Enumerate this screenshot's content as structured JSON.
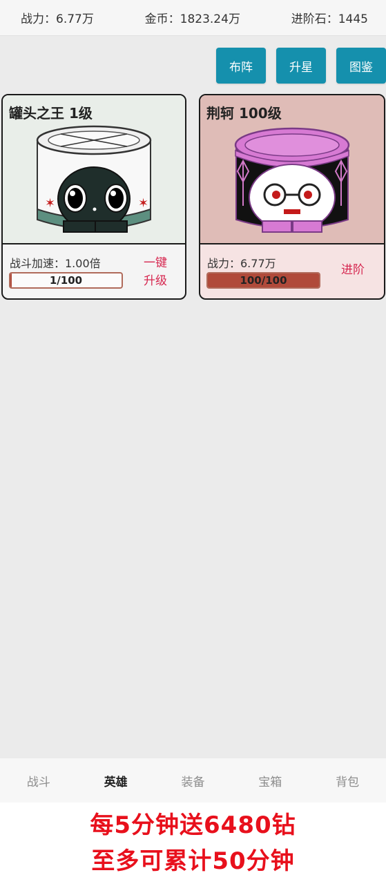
{
  "header": {
    "power": "战力：6.77万",
    "gold": "金币：1823.24万",
    "advance_stone": "进阶石：1445"
  },
  "toolbar": {
    "formation": "布阵",
    "star_up": "升星",
    "codex": "图鉴"
  },
  "heroes": [
    {
      "name": "罐头之王 1级",
      "stat": "战斗加速：1.00倍",
      "progress_text": "1/100",
      "progress": 0.01,
      "action_line1": "一键",
      "action_line2": "升级"
    },
    {
      "name": "荆轲 100级",
      "stat": "战力：6.77万",
      "progress_text": "100/100",
      "progress": 1.0,
      "action": "进阶"
    }
  ],
  "nav": {
    "tabs": [
      "战斗",
      "英雄",
      "装备",
      "宝箱",
      "背包"
    ],
    "active": "英雄"
  },
  "promo": {
    "line1": "每5分钟送6480钻",
    "line2": "至多可累计50分钟"
  },
  "colors": {
    "button": "#1590ad",
    "action_text": "#d6264f",
    "progress_fill": "#b04a3a",
    "promo_text": "#e8101c"
  }
}
